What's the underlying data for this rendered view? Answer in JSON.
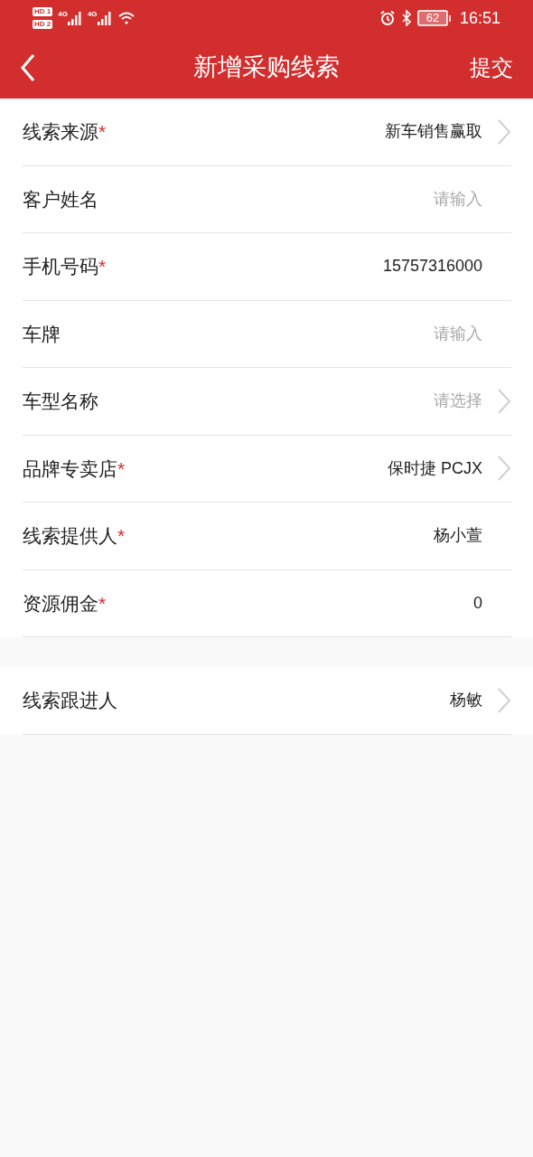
{
  "status_bar": {
    "sim_badges": [
      "HD 1",
      "HD 2"
    ],
    "network_labels": [
      "4G",
      "4G"
    ],
    "battery": "62",
    "time": "16:51"
  },
  "header": {
    "title": "新增采购线索",
    "action": "提交"
  },
  "sections": [
    {
      "rows": [
        {
          "label": "线索来源",
          "mark": "*",
          "kind": "select",
          "value": "新车销售赢取"
        },
        {
          "label": "客户姓名",
          "kind": "input",
          "placeholder": "请输入"
        },
        {
          "label": "手机号码",
          "mark": "*",
          "kind": "input",
          "value": "15757316000"
        },
        {
          "label": "车牌",
          "kind": "input",
          "placeholder": "请输入"
        },
        {
          "label": "车型名称",
          "kind": "select",
          "placeholder": "请选择"
        },
        {
          "label": "品牌专卖店",
          "mark": "*",
          "kind": "select",
          "value": "保时捷 PCJX"
        },
        {
          "label": "线索提供人",
          "mark": "*",
          "kind": "text",
          "value": "杨小萱"
        },
        {
          "label": "资源佣金",
          "mark": "*",
          "kind": "input",
          "value": "0"
        }
      ]
    },
    {
      "rows": [
        {
          "label": "线索跟进人",
          "kind": "select",
          "value": "杨敏"
        }
      ]
    }
  ]
}
